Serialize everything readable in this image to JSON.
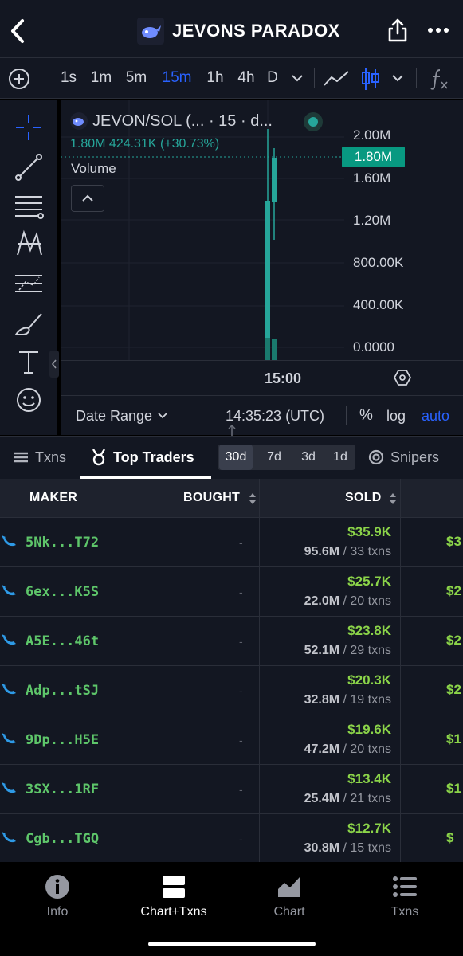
{
  "header": {
    "title": "JEVONS PARADOX"
  },
  "toolbar": {
    "intervals": [
      "1s",
      "1m",
      "5m",
      "15m",
      "1h",
      "4h",
      "D"
    ],
    "active_interval": "15m"
  },
  "chart": {
    "pair_label": "JEVON/SOL (... · 15 · d...",
    "ohlc_line": "1.80M  424.31K (+30.73%)",
    "volume_label": "Volume",
    "price_badge": "1.80M",
    "y_ticks": [
      "2.00M",
      "1.60M",
      "1.20M",
      "800.00K",
      "400.00K",
      "0.0000"
    ],
    "time_label": "15:00",
    "date_range_label": "Date Range",
    "clock": "14:35:23 (UTC)",
    "percent_label": "%",
    "log_label": "log",
    "auto_label": "auto",
    "colors": {
      "up": "#26a69a",
      "accent": "#2962ff",
      "badge": "#089981"
    }
  },
  "tabs": {
    "txns": "Txns",
    "top_traders": "Top Traders",
    "snipers": "Snipers",
    "periods": [
      "30d",
      "7d",
      "3d",
      "1d"
    ],
    "active_period": "30d"
  },
  "table": {
    "headers": {
      "maker": "MAKER",
      "bought": "BOUGHT",
      "sold": "SOLD"
    },
    "rows": [
      {
        "maker": "5Nk...T72",
        "bought": "-",
        "sold_usd": "$35.9K",
        "sold_amount": "95.6M",
        "sold_txns": "33 txns",
        "next": "$3"
      },
      {
        "maker": "6ex...K5S",
        "bought": "-",
        "sold_usd": "$25.7K",
        "sold_amount": "22.0M",
        "sold_txns": "20 txns",
        "next": "$2"
      },
      {
        "maker": "A5E...46t",
        "bought": "-",
        "sold_usd": "$23.8K",
        "sold_amount": "52.1M",
        "sold_txns": "29 txns",
        "next": "$2"
      },
      {
        "maker": "Adp...tSJ",
        "bought": "-",
        "sold_usd": "$20.3K",
        "sold_amount": "32.8M",
        "sold_txns": "19 txns",
        "next": "$2"
      },
      {
        "maker": "9Dp...H5E",
        "bought": "-",
        "sold_usd": "$19.6K",
        "sold_amount": "47.2M",
        "sold_txns": "20 txns",
        "next": "$1"
      },
      {
        "maker": "3SX...1RF",
        "bought": "-",
        "sold_usd": "$13.4K",
        "sold_amount": "25.4M",
        "sold_txns": "21 txns",
        "next": "$1"
      },
      {
        "maker": "Cgb...TGQ",
        "bought": "-",
        "sold_usd": "$12.7K",
        "sold_amount": "30.8M",
        "sold_txns": "15 txns",
        "next": "$"
      }
    ]
  },
  "bottom_nav": {
    "info": "Info",
    "chart_txns": "Chart+Txns",
    "chart": "Chart",
    "txns": "Txns"
  }
}
